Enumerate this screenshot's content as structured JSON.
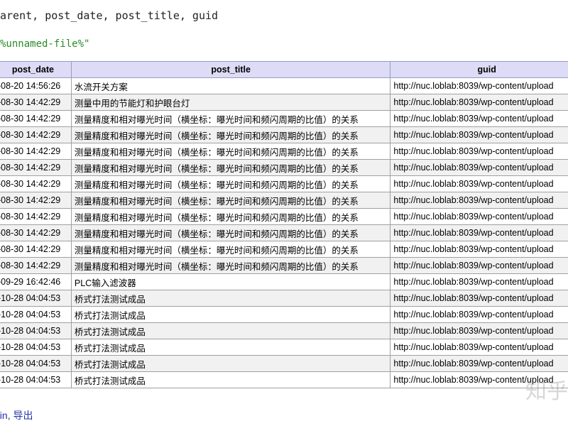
{
  "sql": {
    "columns_line": "arent, post_date, post_title, guid",
    "string_literal": "%unnamed-file%\""
  },
  "table": {
    "headers": [
      "post_date",
      "post_title",
      "guid"
    ],
    "rows": [
      [
        "-08-20 14:56:26",
        "水流开关方案",
        "http://nuc.loblab:8039/wp-content/upload"
      ],
      [
        "-08-30 14:42:29",
        "测量中用的节能灯和护眼台灯",
        "http://nuc.loblab:8039/wp-content/upload"
      ],
      [
        "-08-30 14:42:29",
        "测量精度和相对曝光时间（横坐标：曝光时间和频闪周期的比值）的关系",
        "http://nuc.loblab:8039/wp-content/upload"
      ],
      [
        "-08-30 14:42:29",
        "测量精度和相对曝光时间（横坐标：曝光时间和频闪周期的比值）的关系",
        "http://nuc.loblab:8039/wp-content/upload"
      ],
      [
        "-08-30 14:42:29",
        "测量精度和相对曝光时间（横坐标：曝光时间和频闪周期的比值）的关系",
        "http://nuc.loblab:8039/wp-content/upload"
      ],
      [
        "-08-30 14:42:29",
        "测量精度和相对曝光时间（横坐标：曝光时间和频闪周期的比值）的关系",
        "http://nuc.loblab:8039/wp-content/upload"
      ],
      [
        "-08-30 14:42:29",
        "测量精度和相对曝光时间（横坐标：曝光时间和频闪周期的比值）的关系",
        "http://nuc.loblab:8039/wp-content/upload"
      ],
      [
        "-08-30 14:42:29",
        "测量精度和相对曝光时间（横坐标：曝光时间和频闪周期的比值）的关系",
        "http://nuc.loblab:8039/wp-content/upload"
      ],
      [
        "-08-30 14:42:29",
        "测量精度和相对曝光时间（横坐标：曝光时间和频闪周期的比值）的关系",
        "http://nuc.loblab:8039/wp-content/upload"
      ],
      [
        "-08-30 14:42:29",
        "测量精度和相对曝光时间（横坐标：曝光时间和频闪周期的比值）的关系",
        "http://nuc.loblab:8039/wp-content/upload"
      ],
      [
        "-08-30 14:42:29",
        "测量精度和相对曝光时间（横坐标：曝光时间和频闪周期的比值）的关系",
        "http://nuc.loblab:8039/wp-content/upload"
      ],
      [
        "-08-30 14:42:29",
        "测量精度和相对曝光时间（横坐标：曝光时间和频闪周期的比值）的关系",
        "http://nuc.loblab:8039/wp-content/upload"
      ],
      [
        "-09-29 16:42:46",
        "PLC输入滤波器",
        "http://nuc.loblab:8039/wp-content/upload"
      ],
      [
        "-10-28 04:04:53",
        "桥式打法测试成品",
        "http://nuc.loblab:8039/wp-content/upload"
      ],
      [
        "-10-28 04:04:53",
        "桥式打法测试成品",
        "http://nuc.loblab:8039/wp-content/upload"
      ],
      [
        "-10-28 04:04:53",
        "桥式打法测试成品",
        "http://nuc.loblab:8039/wp-content/upload"
      ],
      [
        "-10-28 04:04:53",
        "桥式打法测试成品",
        "http://nuc.loblab:8039/wp-content/upload"
      ],
      [
        "-10-28 04:04:53",
        "桥式打法测试成品",
        "http://nuc.loblab:8039/wp-content/upload"
      ],
      [
        "-10-28 04:04:53",
        "桥式打法测试成品",
        "http://nuc.loblab:8039/wp-content/upload"
      ]
    ]
  },
  "footer": {
    "link_left": "ain",
    "separator": ", ",
    "link_export": "导出"
  },
  "watermark": "知乎",
  "colors": {
    "header_bg": "#dcdcf6",
    "string_literal": "#2a8a2a",
    "link": "#2233aa",
    "row_alt": "#f1f1f1"
  }
}
